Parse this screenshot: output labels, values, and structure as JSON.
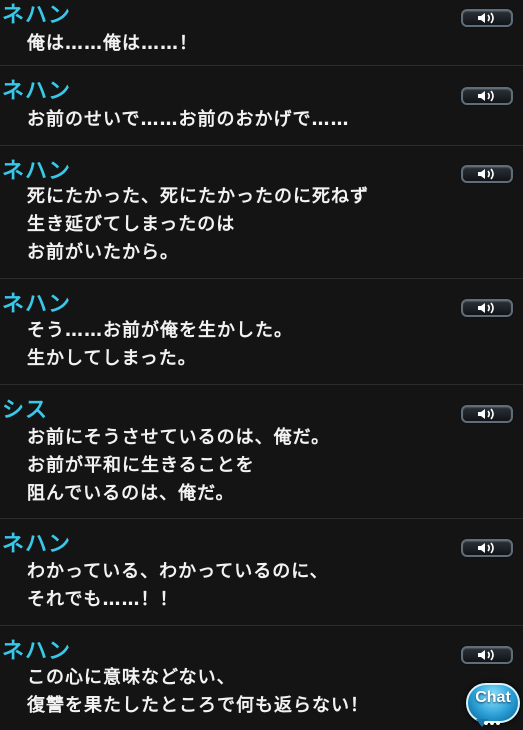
{
  "entries": [
    {
      "speaker": "ネハン",
      "lines": [
        "俺は……俺は……！"
      ]
    },
    {
      "speaker": "ネハン",
      "lines": [
        "お前のせいで……お前のおかげで……"
      ]
    },
    {
      "speaker": "ネハン",
      "lines": [
        "死にたかった、死にたかったのに死ねず",
        "生き延びてしまったのは",
        "お前がいたから。"
      ]
    },
    {
      "speaker": "ネハン",
      "lines": [
        "そう……お前が俺を生かした。",
        "生かしてしまった。"
      ]
    },
    {
      "speaker": "シス",
      "lines": [
        "お前にそうさせているのは、俺だ。",
        "お前が平和に生きることを",
        "阻んでいるのは、俺だ。"
      ]
    },
    {
      "speaker": "ネハン",
      "lines": [
        "わかっている、わかっているのに、",
        "それでも……！！"
      ]
    },
    {
      "speaker": "ネハン",
      "lines": [
        "この心に意味などない、",
        "復讐を果たしたところで何も返らない！"
      ]
    }
  ],
  "voice_button_icon": "speaker-icon",
  "chat_button": {
    "label": "Chat",
    "icon": "chat-bubble-icon"
  },
  "colors": {
    "background": "#141414",
    "speaker_name": "#37c8ea",
    "dialogue_text": "#f2f2f2",
    "chat_accent": "#2a9fd6"
  }
}
